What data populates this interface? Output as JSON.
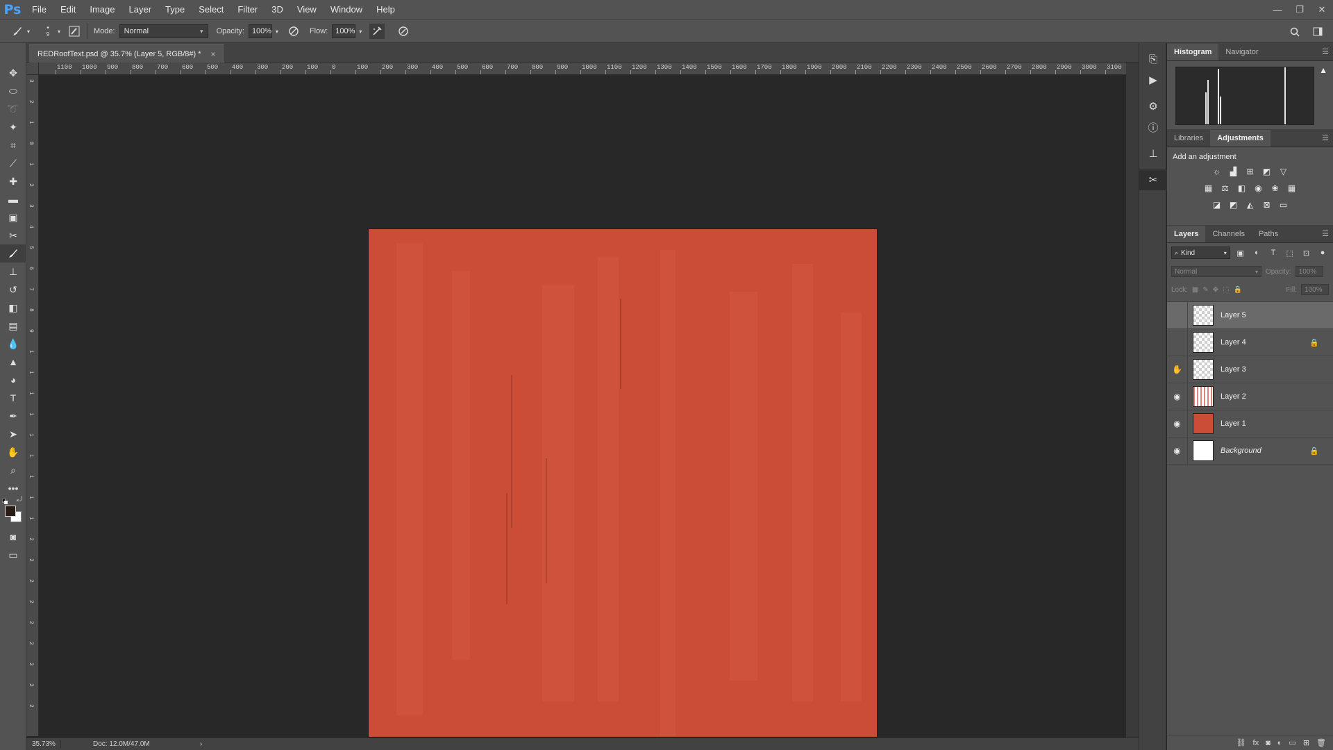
{
  "app": {
    "logo": "Ps"
  },
  "menu": [
    "File",
    "Edit",
    "Image",
    "Layer",
    "Type",
    "Select",
    "Filter",
    "3D",
    "View",
    "Window",
    "Help"
  ],
  "window_controls": {
    "minimize": "—",
    "restore": "❐",
    "close": "✕"
  },
  "options": {
    "brush_size": "9",
    "mode_label": "Mode:",
    "mode_value": "Normal",
    "opacity_label": "Opacity:",
    "opacity_value": "100%",
    "flow_label": "Flow:",
    "flow_value": "100%"
  },
  "document": {
    "tab_title": "REDRoofText.psd @ 35.7% (Layer 5, RGB/8#) *",
    "tab_close": "×",
    "canvas_color": "#cc4d37"
  },
  "ruler_top_labels": [
    "1100",
    "1000",
    "900",
    "800",
    "700",
    "600",
    "500",
    "400",
    "300",
    "200",
    "100",
    "0",
    "100",
    "200",
    "300",
    "400",
    "500",
    "600",
    "700",
    "800",
    "900",
    "1000",
    "1100",
    "1200",
    "1300",
    "1400",
    "1500",
    "1600",
    "1700",
    "1800",
    "1900",
    "2000",
    "2100",
    "2200",
    "2300",
    "2400",
    "2500",
    "2600",
    "2700",
    "2800",
    "2900",
    "3000",
    "3100"
  ],
  "ruler_left_labels": [
    "3",
    "2",
    "1",
    "0",
    "1",
    "2",
    "3",
    "4",
    "5",
    "6",
    "7",
    "8",
    "9",
    "1",
    "1",
    "1",
    "1",
    "1",
    "1",
    "1",
    "1",
    "1",
    "2",
    "2",
    "2",
    "2",
    "2",
    "2",
    "2",
    "2",
    "2"
  ],
  "status": {
    "zoom": "35.73%",
    "doc": "Doc: 12.0M/47.0M",
    "arrow": "›"
  },
  "panels": {
    "top_tabs": [
      "Histogram",
      "Navigator"
    ],
    "mid_tabs": [
      "Libraries",
      "Adjustments"
    ],
    "adjust_title": "Add an adjustment",
    "layer_tabs": [
      "Layers",
      "Channels",
      "Paths"
    ],
    "filter_kind": "Kind",
    "blend_mode": "Normal",
    "opacity_label": "Opacity:",
    "opacity_value": "100%",
    "lock_label": "Lock:",
    "fill_label": "Fill:",
    "fill_value": "100%"
  },
  "layers": [
    {
      "name": "Layer 5",
      "visible": false,
      "thumb": "checker",
      "selected": true,
      "locked": false
    },
    {
      "name": "Layer 4",
      "visible": false,
      "thumb": "checker",
      "selected": false,
      "locked": true
    },
    {
      "name": "Layer 3",
      "visible": false,
      "thumb": "checker",
      "selected": false,
      "locked": false,
      "hover": true
    },
    {
      "name": "Layer 2",
      "visible": true,
      "thumb": "strokes",
      "selected": false,
      "locked": false
    },
    {
      "name": "Layer 1",
      "visible": true,
      "thumb": "red",
      "selected": false,
      "locked": false
    },
    {
      "name": "Background",
      "visible": true,
      "thumb": "white",
      "selected": false,
      "locked": true,
      "italic": true
    }
  ],
  "icons": {
    "eye": "👁",
    "hand": "✋",
    "lock": "🔒",
    "search": "🔍",
    "warning": "▲"
  }
}
